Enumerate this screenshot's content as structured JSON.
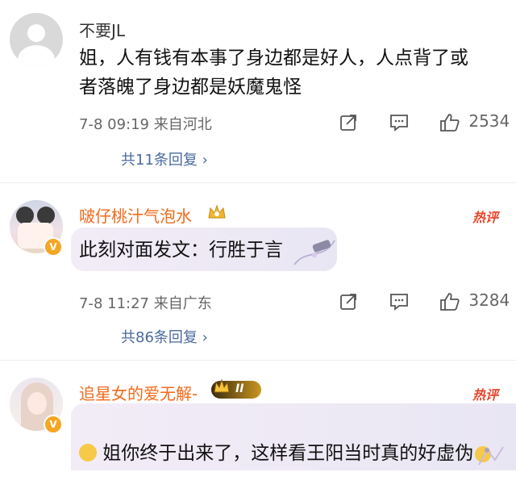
{
  "comments": [
    {
      "username": "不要JL",
      "content": "姐，人有钱有本事了身边都是好人，人点背了或\n者落魄了身边都是妖魔鬼怪",
      "meta": "7-8 09:19 来自河北",
      "likes": "2534",
      "replies": "共11条回复 ›"
    },
    {
      "username": "啵仔桃汁气泡水",
      "hot_label": "热评",
      "content": "此刻对面发文：行胜于言",
      "meta": "7-8 11:27 来自广东",
      "likes": "3284",
      "replies": "共86条回复 ›"
    },
    {
      "username": "追星女的爱无解-",
      "badge": "II",
      "hot_label": "热评",
      "content": "姐你终于出来了，这样看王阳当时真的好虚伪"
    }
  ],
  "colors": {
    "username_orange": "#f26a1b",
    "reply_link": "#4a6a9e",
    "hot": "#e8452b"
  }
}
